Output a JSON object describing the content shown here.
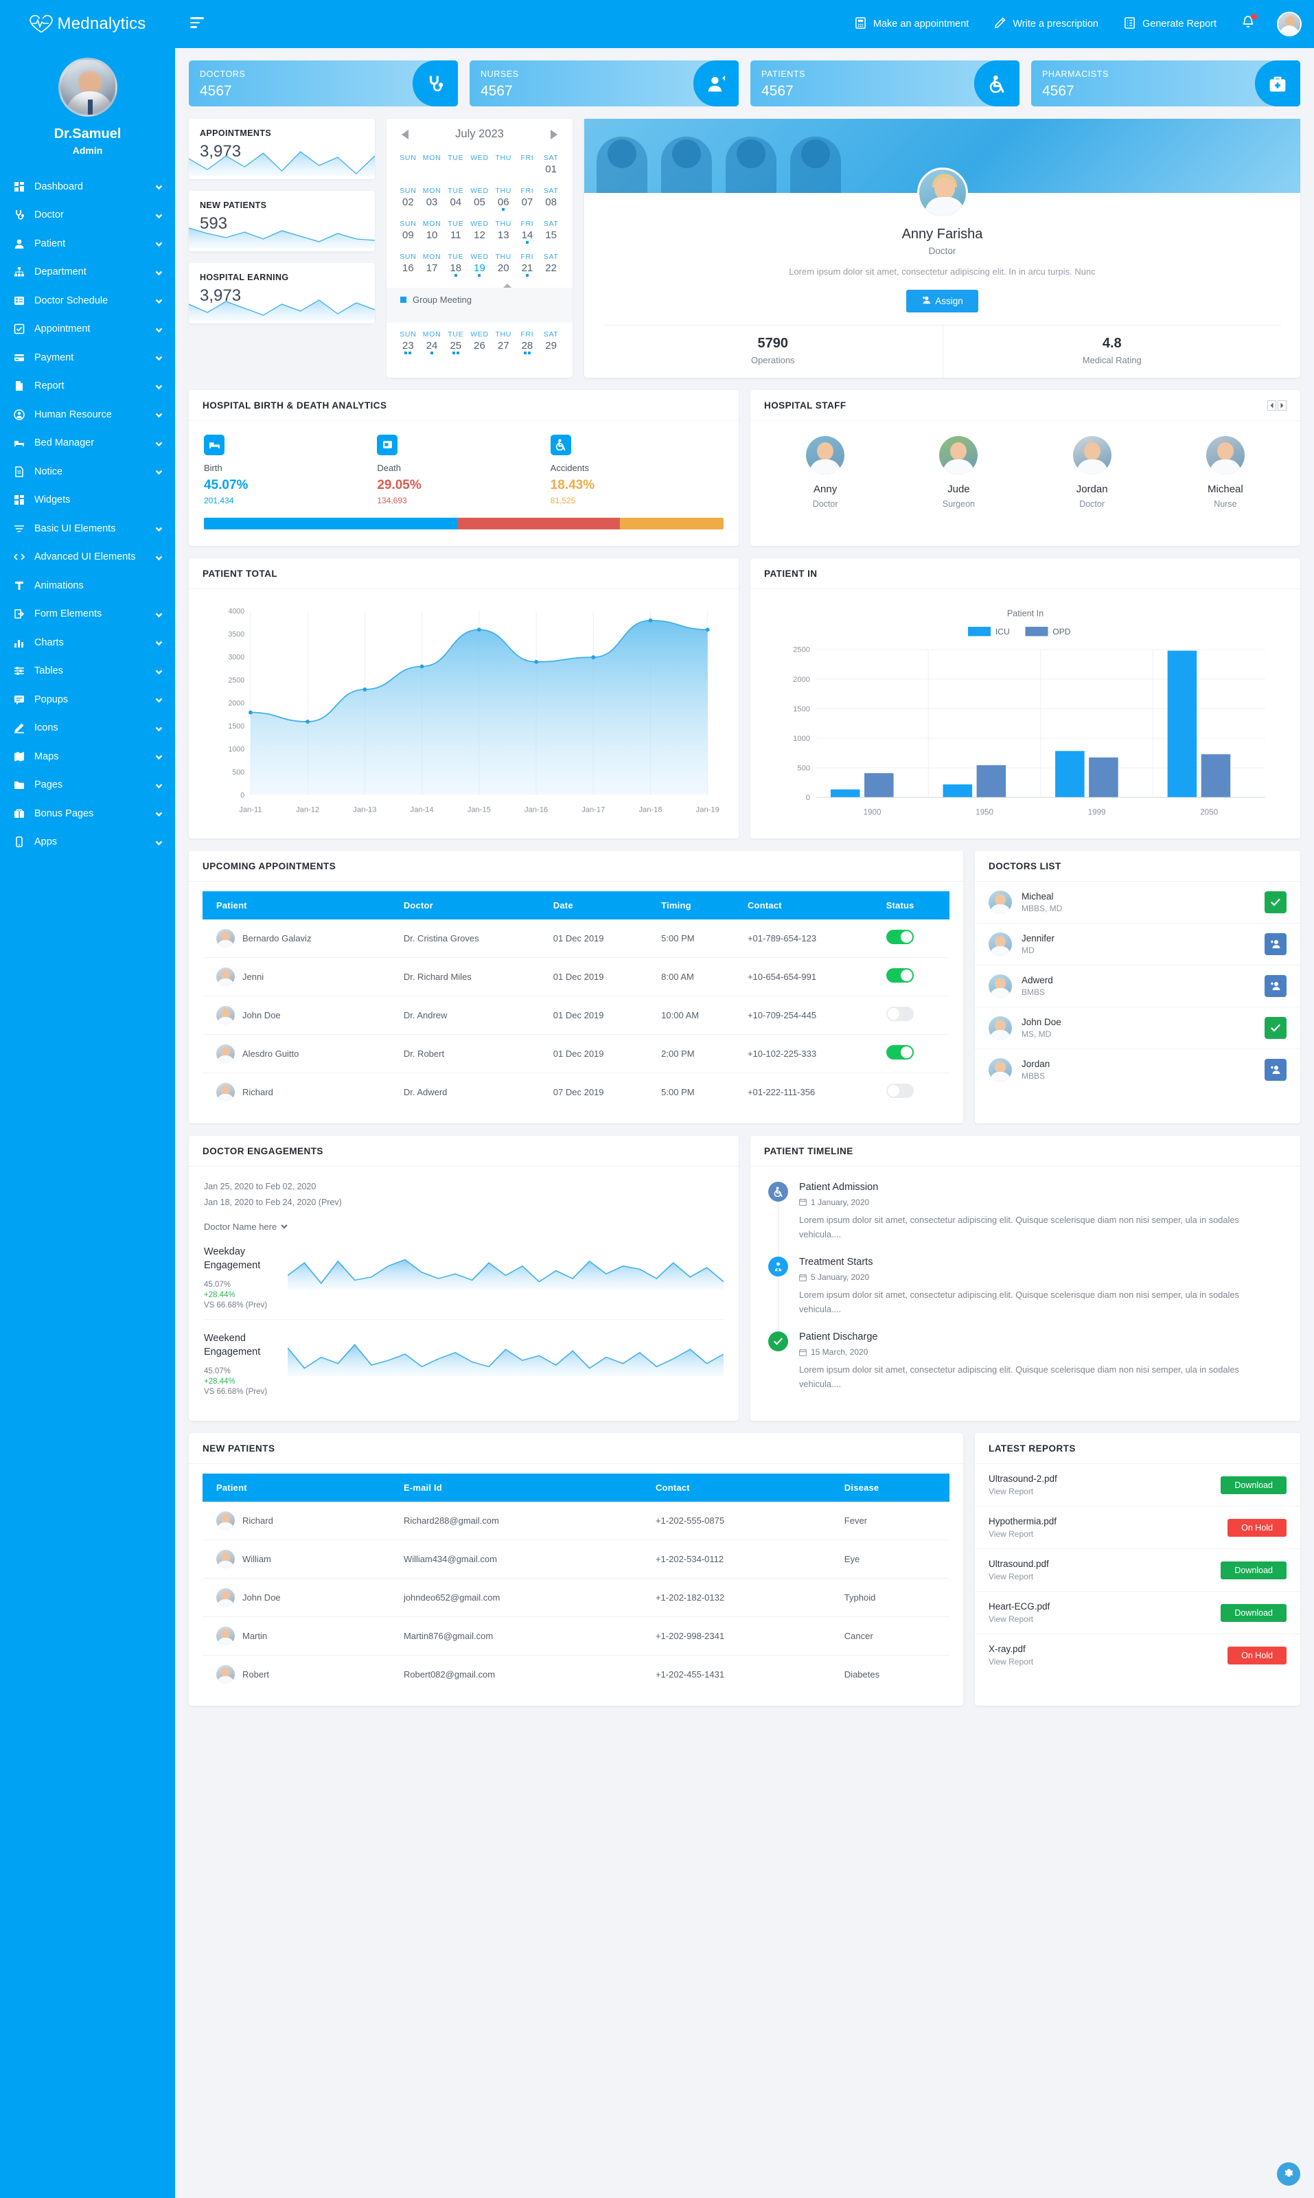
{
  "brand": {
    "name": "Mednalytics",
    "logo_icon": "heartbeat-icon"
  },
  "profile": {
    "name": "Dr.Samuel",
    "role": "Admin"
  },
  "sidebar": {
    "items": [
      {
        "label": "Dashboard",
        "icon": "grid-icon",
        "caret": true
      },
      {
        "label": "Doctor",
        "icon": "stethoscope-icon",
        "caret": true
      },
      {
        "label": "Patient",
        "icon": "user-icon",
        "caret": true
      },
      {
        "label": "Department",
        "icon": "sitemap-icon",
        "caret": true
      },
      {
        "label": "Doctor Schedule",
        "icon": "list-icon",
        "caret": true
      },
      {
        "label": "Appointment",
        "icon": "check-square-icon",
        "caret": true
      },
      {
        "label": "Payment",
        "icon": "credit-card-icon",
        "caret": true
      },
      {
        "label": "Report",
        "icon": "file-icon",
        "caret": true
      },
      {
        "label": "Human Resource",
        "icon": "user-circle-icon",
        "caret": true
      },
      {
        "label": "Bed Manager",
        "icon": "bed-icon",
        "caret": true
      },
      {
        "label": "Notice",
        "icon": "document-icon",
        "caret": true
      },
      {
        "label": "Widgets",
        "icon": "widgets-icon",
        "caret": false
      },
      {
        "label": "Basic UI Elements",
        "icon": "filter-icon",
        "caret": true
      },
      {
        "label": "Advanced UI Elements",
        "icon": "code-icon",
        "caret": true
      },
      {
        "label": "Animations",
        "icon": "animation-icon",
        "caret": false
      },
      {
        "label": "Form Elements",
        "icon": "form-icon",
        "caret": true
      },
      {
        "label": "Charts",
        "icon": "bar-chart-icon",
        "caret": true
      },
      {
        "label": "Tables",
        "icon": "sliders-icon",
        "caret": true
      },
      {
        "label": "Popups",
        "icon": "chat-icon",
        "caret": true
      },
      {
        "label": "Icons",
        "icon": "pencil-icon",
        "caret": true
      },
      {
        "label": "Maps",
        "icon": "map-icon",
        "caret": true
      },
      {
        "label": "Pages",
        "icon": "folder-icon",
        "caret": true
      },
      {
        "label": "Bonus Pages",
        "icon": "bonus-icon",
        "caret": true
      },
      {
        "label": "Apps",
        "icon": "apps-icon",
        "caret": true
      }
    ]
  },
  "topbar": {
    "menu_icon": "hamburger-icon",
    "actions": [
      {
        "label": "Make an appointment",
        "icon": "calculator-icon"
      },
      {
        "label": "Write a prescription",
        "icon": "pencil-icon"
      },
      {
        "label": "Generate Report",
        "icon": "report-list-icon"
      }
    ],
    "notification_icon": "bell-icon",
    "has_notification": true,
    "avatar_icon": "user-avatar"
  },
  "stats": [
    {
      "title": "DOCTORS",
      "value": "4567",
      "icon": "stethoscope-icon"
    },
    {
      "title": "NURSES",
      "value": "4567",
      "icon": "nurse-icon"
    },
    {
      "title": "PATIENTS",
      "value": "4567",
      "icon": "wheelchair-icon"
    },
    {
      "title": "PHARMACISTS",
      "value": "4567",
      "icon": "medkit-icon"
    }
  ],
  "mini_cards": [
    {
      "title": "APPOINTMENTS",
      "value": "3,973"
    },
    {
      "title": "NEW PATIENTS",
      "value": "593"
    },
    {
      "title": "HOSPITAL EARNING",
      "value": "3,973"
    }
  ],
  "calendar": {
    "month_title": "July 2023",
    "prev_icon": "caret-left-icon",
    "next_icon": "caret-right-icon",
    "dow": [
      "SUN",
      "MON",
      "TUE",
      "WED",
      "THU",
      "FRI",
      "SAT"
    ],
    "weeks": [
      [
        {
          "d": ""
        },
        {
          "d": ""
        },
        {
          "d": ""
        },
        {
          "d": ""
        },
        {
          "d": ""
        },
        {
          "d": ""
        },
        {
          "d": "01",
          "dots": 0
        }
      ],
      [
        {
          "d": "02",
          "dots": 0
        },
        {
          "d": "03",
          "dots": 0
        },
        {
          "d": "04",
          "dots": 0
        },
        {
          "d": "05",
          "dots": 0
        },
        {
          "d": "06",
          "dots": 1
        },
        {
          "d": "07",
          "dots": 0
        },
        {
          "d": "08",
          "dots": 0
        }
      ],
      [
        {
          "d": "09",
          "dots": 0
        },
        {
          "d": "10",
          "dots": 0
        },
        {
          "d": "11",
          "dots": 0
        },
        {
          "d": "12",
          "dots": 0
        },
        {
          "d": "13",
          "dots": 0
        },
        {
          "d": "14",
          "dots": 1
        },
        {
          "d": "15",
          "dots": 0
        }
      ],
      [
        {
          "d": "16",
          "dots": 0
        },
        {
          "d": "17",
          "dots": 0
        },
        {
          "d": "18",
          "dots": 1
        },
        {
          "d": "19",
          "dots": 1,
          "today": true
        },
        {
          "d": "20",
          "dots": 0
        },
        {
          "d": "21",
          "dots": 1
        },
        {
          "d": "22",
          "dots": 0
        }
      ]
    ],
    "event": {
      "label": "Group Meeting"
    },
    "last_week": [
      {
        "d": "23",
        "dots": 2
      },
      {
        "d": "24",
        "dots": 1
      },
      {
        "d": "25",
        "dots": 2
      },
      {
        "d": "26",
        "dots": 0
      },
      {
        "d": "27",
        "dots": 0
      },
      {
        "d": "28",
        "dots": 2
      },
      {
        "d": "29",
        "dots": 0
      }
    ]
  },
  "feature_doctor": {
    "name": "Anny Farisha",
    "role": "Doctor",
    "description": "Lorem ipsum dolor sit amet, consectetur adipiscing elit. In in arcu turpis. Nunc",
    "assign_label": "Assign",
    "assign_icon": "user-plus-icon",
    "stats": [
      {
        "value": "5790",
        "label": "Operations"
      },
      {
        "value": "4.8",
        "label": "Medical Rating"
      }
    ]
  },
  "birth_death": {
    "title": "HOSPITAL BIRTH & DEATH ANALYTICS",
    "items": [
      {
        "label": "Birth",
        "pct": "45.07%",
        "count": "201,434",
        "color": "#00a2f3",
        "icon": "bed-icon"
      },
      {
        "label": "Death",
        "pct": "29.05%",
        "count": "134,693",
        "color": "#dd5a52",
        "icon": "tomb-icon"
      },
      {
        "label": "Accidents",
        "pct": "18.43%",
        "count": "81,525",
        "color": "#eeab47",
        "icon": "wheelchair-icon"
      }
    ]
  },
  "hospital_staff": {
    "title": "HOSPITAL STAFF",
    "prev_icon": "chevron-left-icon",
    "next_icon": "chevron-right-icon",
    "members": [
      {
        "name": "Anny",
        "role": "Doctor"
      },
      {
        "name": "Jude",
        "role": "Surgeon"
      },
      {
        "name": "Jordan",
        "role": "Doctor"
      },
      {
        "name": "Micheal",
        "role": "Nurse"
      }
    ]
  },
  "chart_data": [
    {
      "type": "area",
      "title": "PATIENT TOTAL",
      "x": [
        "Jan-11",
        "Jan-12",
        "Jan-13",
        "Jan-14",
        "Jan-15",
        "Jan-16",
        "Jan-17",
        "Jan-18",
        "Jan-19"
      ],
      "values": [
        1790,
        1590,
        2290,
        2790,
        3590,
        2890,
        2990,
        3790,
        3590
      ],
      "xlabel": "",
      "ylabel": "",
      "ylim": [
        0,
        4000
      ],
      "yticks": [
        0,
        500,
        1000,
        1500,
        2000,
        2500,
        3000,
        3500,
        4000
      ],
      "grid": true,
      "legend": "none",
      "color": "#3eb0ea"
    },
    {
      "type": "bar",
      "title": "PATIENT IN",
      "subtitle": "Patient In",
      "categories": [
        "1900",
        "1950",
        "1999",
        "2050"
      ],
      "series": [
        {
          "name": "ICU",
          "values": [
            135,
            220,
            785,
            2480
          ],
          "color": "#17a2f5"
        },
        {
          "name": "OPD",
          "values": [
            410,
            545,
            675,
            730
          ],
          "color": "#5b8ac5"
        }
      ],
      "xlabel": "",
      "ylabel": "",
      "ylim": [
        0,
        2500
      ],
      "yticks": [
        0,
        500,
        1000,
        1500,
        2000,
        2500
      ],
      "grid": true,
      "legend": "top"
    }
  ],
  "appointments": {
    "title": "UPCOMING APPOINTMENTS",
    "columns": [
      "Patient",
      "Doctor",
      "Date",
      "Timing",
      "Contact",
      "Status"
    ],
    "rows": [
      {
        "patient": "Bernardo Galaviz",
        "doctor": "Dr. Cristina Groves",
        "date": "01 Dec 2019",
        "timing": "5:00 PM",
        "contact": "+01-789-654-123",
        "status": "on"
      },
      {
        "patient": "Jenni",
        "doctor": "Dr. Richard Miles",
        "date": "01 Dec 2019",
        "timing": "8:00 AM",
        "contact": "+10-654-654-991",
        "status": "on"
      },
      {
        "patient": "John Doe",
        "doctor": "Dr. Andrew",
        "date": "01 Dec 2019",
        "timing": "10:00 AM",
        "contact": "+10-709-254-445",
        "status": "off"
      },
      {
        "patient": "Alesdro Guitto",
        "doctor": "Dr. Robert",
        "date": "01 Dec 2019",
        "timing": "2:00 PM",
        "contact": "+10-102-225-333",
        "status": "on"
      },
      {
        "patient": "Richard",
        "doctor": "Dr. Adwerd",
        "date": "07 Dec 2019",
        "timing": "5:00 PM",
        "contact": "+01-222-111-356",
        "status": "off"
      }
    ]
  },
  "doctors_list": {
    "title": "DOCTORS LIST",
    "rows": [
      {
        "name": "Micheal",
        "degree": "MBBS, MD",
        "action": "check",
        "action_icon": "check-icon"
      },
      {
        "name": "Jennifer",
        "degree": "MD",
        "action": "add",
        "action_icon": "user-plus-icon"
      },
      {
        "name": "Adwerd",
        "degree": "BMBS",
        "action": "add",
        "action_icon": "user-plus-icon"
      },
      {
        "name": "John Doe",
        "degree": "MS, MD",
        "action": "check",
        "action_icon": "check-icon"
      },
      {
        "name": "Jordan",
        "degree": "MBBS",
        "action": "add",
        "action_icon": "user-plus-icon"
      }
    ]
  },
  "engagements": {
    "title": "DOCTOR ENGAGEMENTS",
    "date_range": "Jan 25, 2020 to Feb 02, 2020",
    "date_range_prev": "Jan 18, 2020 to Feb 24, 2020 (Prev)",
    "doctor_select": "Doctor Name here",
    "blocks": [
      {
        "title": "Weekday Engagement",
        "pct": "45.07%",
        "change": "+28.44%",
        "prev": "VS 66.68% (Prev)"
      },
      {
        "title": "Weekend Engagement",
        "pct": "45.07%",
        "change": "+28.44%",
        "prev": "VS 66.68% (Prev)"
      }
    ]
  },
  "timeline": {
    "title": "PATIENT TIMELINE",
    "items": [
      {
        "title": "Patient Admission",
        "date": "1 January, 2020",
        "text": "Lorem ipsum dolor sit amet, consectetur adipiscing elit. Quisque scelerisque diam non nisi semper, ula in sodales vehicula....",
        "color": "#5b8ac5",
        "icon": "wheelchair-icon"
      },
      {
        "title": "Treatment Starts",
        "date": "5 January, 2020",
        "text": "Lorem ipsum dolor sit amet, consectetur adipiscing elit. Quisque scelerisque diam non nisi semper, ula in sodales vehicula....",
        "color": "#17a2f5",
        "icon": "doctor-icon"
      },
      {
        "title": "Patient Discharge",
        "date": "15 March, 2020",
        "text": "Lorem ipsum dolor sit amet, consectetur adipiscing elit. Quisque scelerisque diam non nisi semper, ula in sodales vehicula....",
        "color": "#1aab52",
        "icon": "check-icon"
      }
    ]
  },
  "new_patients": {
    "title": "NEW PATIENTS",
    "columns": [
      "Patient",
      "E-mail Id",
      "Contact",
      "Disease"
    ],
    "rows": [
      {
        "patient": "Richard",
        "email": "Richard288@gmail.com",
        "contact": "+1-202-555-0875",
        "disease": "Fever"
      },
      {
        "patient": "William",
        "email": "William434@gmail.com",
        "contact": "+1-202-534-0112",
        "disease": "Eye"
      },
      {
        "patient": "John Doe",
        "email": "johndeo652@gmail.com",
        "contact": "+1-202-182-0132",
        "disease": "Typhoid"
      },
      {
        "patient": "Martin",
        "email": "Martin876@gmail.com",
        "contact": "+1-202-998-2341",
        "disease": "Cancer"
      },
      {
        "patient": "Robert",
        "email": "Robert082@gmail.com",
        "contact": "+1-202-455-1431",
        "disease": "Diabetes"
      }
    ]
  },
  "latest_reports": {
    "title": "LATEST REPORTS",
    "view_label": "View Report",
    "rows": [
      {
        "name": "Ultrasound-2.pdf",
        "sub": "View Report",
        "action": "Download",
        "type": "download"
      },
      {
        "name": "Hypothermia.pdf",
        "sub": "View Report",
        "action": "On Hold",
        "type": "hold"
      },
      {
        "name": "Ultrasound.pdf",
        "sub": "View Report",
        "action": "Download",
        "type": "download"
      },
      {
        "name": "Heart-ECG.pdf",
        "sub": "View Report",
        "action": "Download",
        "type": "download"
      },
      {
        "name": "X-ray.pdf",
        "sub": "View Report",
        "action": "On Hold",
        "type": "hold"
      }
    ]
  },
  "fab": {
    "icon": "gear-icon"
  },
  "colors": {
    "primary": "#00a2f3",
    "green": "#17ab52",
    "red": "#f3453f",
    "orange": "#eeab47"
  }
}
